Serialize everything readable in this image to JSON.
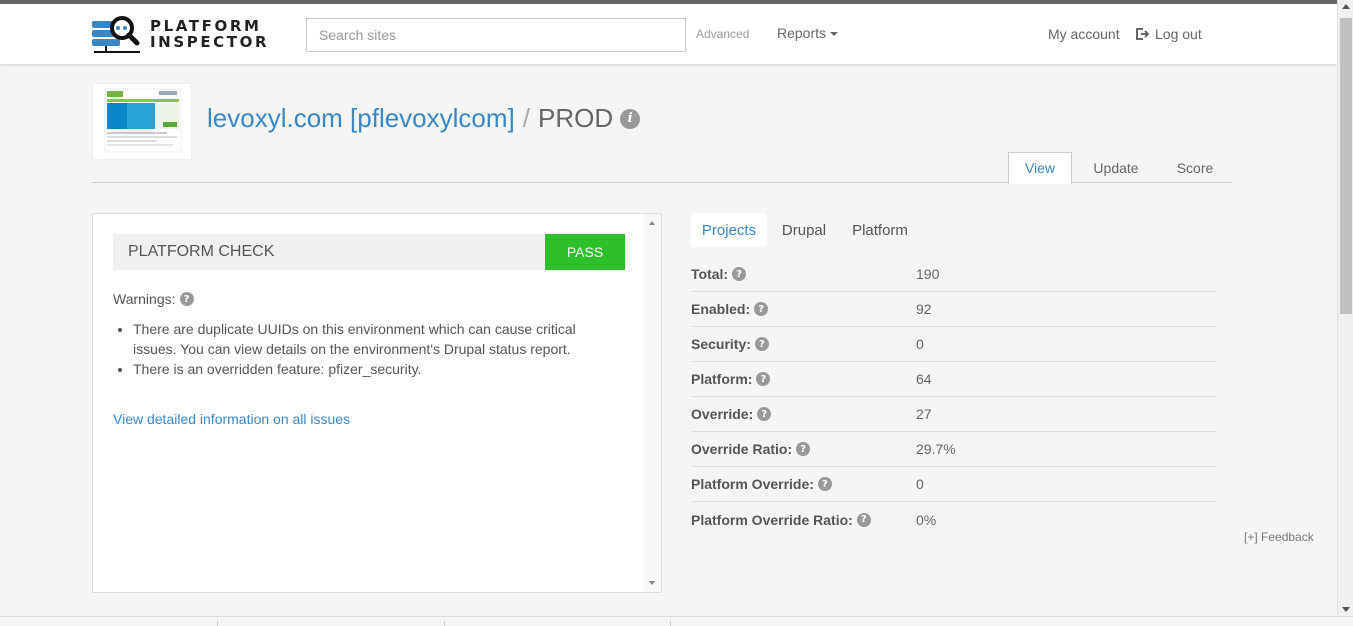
{
  "brand": {
    "line1": "PLATFORM",
    "line2": "INSPECTOR"
  },
  "search": {
    "placeholder": "Search sites"
  },
  "nav": {
    "advanced": "Advanced",
    "reports": "Reports",
    "my_account": "My account",
    "logout": "Log out"
  },
  "site": {
    "name": "levoxyl.com [pflevoxylcom]",
    "separator": "/",
    "environment": "PROD",
    "info_glyph": "i"
  },
  "main_tabs": [
    {
      "label": "View"
    },
    {
      "label": "Update"
    },
    {
      "label": "Score"
    }
  ],
  "platform_check": {
    "title": "PLATFORM CHECK",
    "status": "PASS",
    "status_color": "#2ec02a",
    "warnings_label": "Warnings:",
    "warnings": [
      "There are duplicate UUIDs on this environment which can cause critical issues. You can view details on the environment's Drupal status report.",
      "There is an overridden feature: pfizer_security."
    ],
    "detail_link": "View detailed information on all issues"
  },
  "sub_tabs": [
    {
      "label": "Projects"
    },
    {
      "label": "Drupal"
    },
    {
      "label": "Platform"
    }
  ],
  "stats": [
    {
      "label": "Total:",
      "value": "190"
    },
    {
      "label": "Enabled:",
      "value": "92"
    },
    {
      "label": "Security:",
      "value": "0"
    },
    {
      "label": "Platform:",
      "value": "64"
    },
    {
      "label": "Override:",
      "value": "27"
    },
    {
      "label": "Override Ratio:",
      "value": "29.7%"
    },
    {
      "label": "Platform Override:",
      "value": "0"
    },
    {
      "label": "Platform Override Ratio:",
      "value": "0%"
    }
  ],
  "feedback": "[+] Feedback",
  "help_glyph": "?",
  "colors": {
    "link": "#3a87c8",
    "pass": "#2ec02a"
  }
}
